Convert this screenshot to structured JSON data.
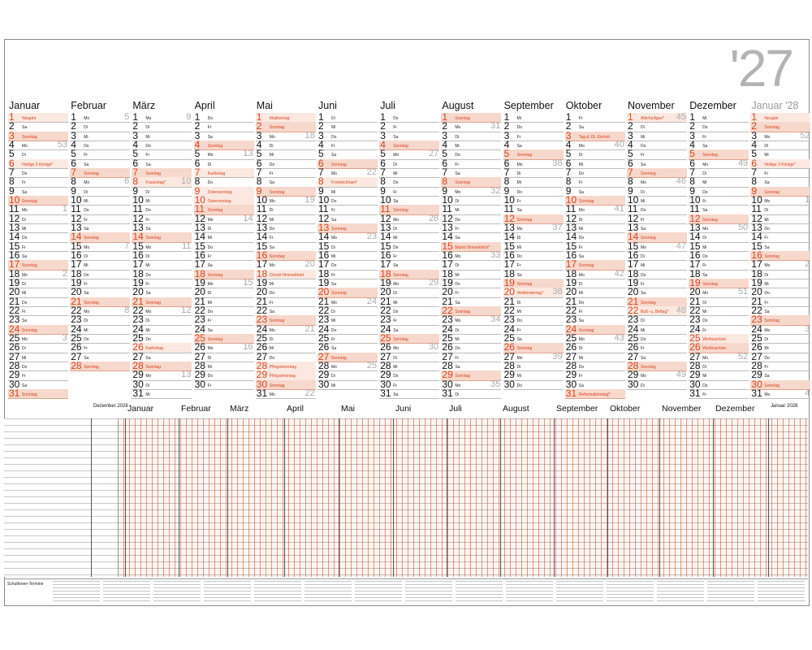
{
  "year_label": "'27",
  "weekday_names": [
    "Mo",
    "Di",
    "Mi",
    "Do",
    "Fr",
    "Sa",
    "So"
  ],
  "sunday_label": "Sonntag",
  "planner": {
    "months": [
      "Dezember 2026",
      "Januar",
      "Februar",
      "März",
      "April",
      "Mai",
      "Juni",
      "Juli",
      "August",
      "September",
      "Oktober",
      "November",
      "Dezember",
      "Januar 2028"
    ],
    "footer_title": "Schulferien-Termine"
  },
  "months": [
    {
      "name": "Januar",
      "days": 31,
      "start": 4,
      "kw_start": 53,
      "holidays": {
        "1": "Neujahr",
        "6": "Heilige 3 Könige*"
      }
    },
    {
      "name": "Februar",
      "days": 28,
      "start": 0,
      "kw_start": 5,
      "holidays": {}
    },
    {
      "name": "März",
      "days": 31,
      "start": 0,
      "kw_start": 9,
      "holidays": {
        "8": "Frauentag*",
        "26": "Karfreitag"
      }
    },
    {
      "name": "April",
      "days": 30,
      "start": 3,
      "kw_start": 13,
      "holidays": {
        "7": "Karfreitag",
        "9": "Ostersonntag",
        "10": "Ostermontag"
      }
    },
    {
      "name": "Mai",
      "days": 31,
      "start": 5,
      "kw_start": 18,
      "holidays": {
        "1": "Maifeiertag",
        "18": "Christi Himmelfahrt",
        "28": "Pfingstsonntag",
        "29": "Pfingstmontag"
      }
    },
    {
      "name": "Juni",
      "days": 30,
      "start": 1,
      "kw_start": 22,
      "holidays": {
        "8": "Fronleichnam*"
      }
    },
    {
      "name": "Juli",
      "days": 31,
      "start": 3,
      "kw_start": 27,
      "holidays": {}
    },
    {
      "name": "August",
      "days": 31,
      "start": 6,
      "kw_start": 31,
      "holidays": {
        "15": "Mariä Himmelfahrt*"
      }
    },
    {
      "name": "September",
      "days": 30,
      "start": 2,
      "kw_start": 36,
      "holidays": {
        "20": "Weltkindertag*"
      }
    },
    {
      "name": "Oktober",
      "days": 31,
      "start": 4,
      "kw_start": 40,
      "holidays": {
        "3": "Tag d. Dt. Einheit",
        "31": "Reformationstag*"
      }
    },
    {
      "name": "November",
      "days": 30,
      "start": 0,
      "kw_start": 45,
      "holidays": {
        "1": "Allerheiligen*",
        "22": "Buß- u. Bettag*"
      }
    },
    {
      "name": "Dezember",
      "days": 31,
      "start": 2,
      "kw_start": 49,
      "holidays": {
        "25": "Weihnachten",
        "26": "Weihnachten"
      }
    },
    {
      "name": "Januar '28",
      "days": 31,
      "start": 5,
      "kw_start": 52,
      "holidays": {
        "1": "Neujahr",
        "6": "Heilige 3 Könige*"
      }
    }
  ]
}
